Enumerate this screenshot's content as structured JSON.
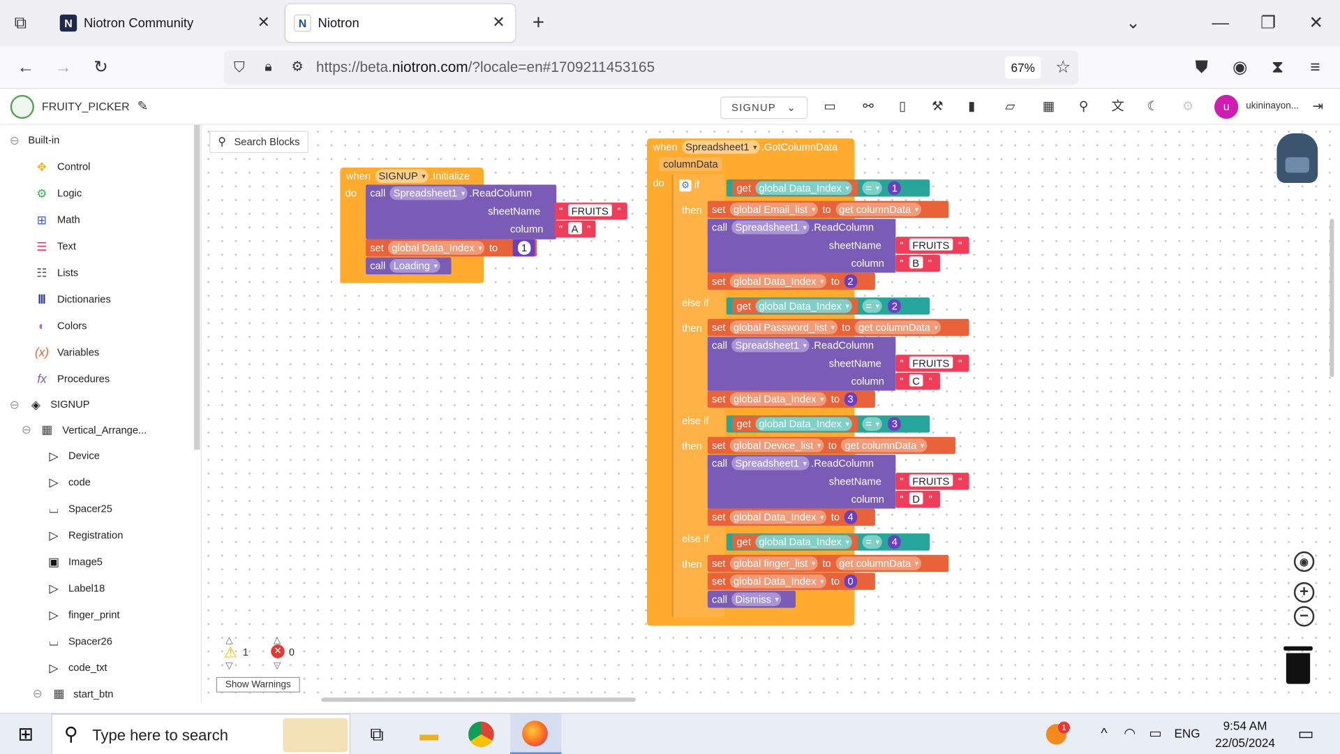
{
  "browser": {
    "tabs": [
      {
        "label": "Niotron Community"
      },
      {
        "label": "Niotron"
      }
    ],
    "url_prefix": "https://beta.",
    "url_domain": "niotron.com",
    "url_suffix": "/?locale=en#1709211453165",
    "zoom": "67%"
  },
  "header": {
    "project_name": "FRUITY_PICKER",
    "screen": "SIGNUP",
    "avatar_letter": "u",
    "username": "ukininayon..."
  },
  "sidebar": {
    "builtin_label": "Built-in",
    "builtin": [
      "Control",
      "Logic",
      "Math",
      "Text",
      "Lists",
      "Dictionaries",
      "Colors",
      "Variables",
      "Procedures"
    ],
    "screen_label": "SIGNUP",
    "arrangement_label": "Vertical_Arrange...",
    "components": [
      "Device",
      "code",
      "Spacer25",
      "Registration",
      "Image5",
      "Label18",
      "finger_print",
      "Spacer26",
      "code_txt"
    ],
    "last_label": "start_btn"
  },
  "workspace": {
    "search_label": "Search Blocks",
    "warnings_count": "1",
    "errors_count": "0",
    "show_warnings": "Show Warnings"
  },
  "blocks": {
    "kw": {
      "when": "when",
      "do": "do",
      "call": "call",
      "set": "set",
      "to": "to",
      "get": "get",
      "if": "if",
      "then": "then",
      "elseif": "else if",
      "eq": "=",
      "sheet": "sheetName",
      "col": "column"
    },
    "init": {
      "component": "SIGNUP",
      "event": ".Initialize",
      "spreadsheet": "Spreadsheet1",
      "method": ".ReadColumn",
      "sheet": "FRUITS",
      "column": "A",
      "var": "global Data_Index",
      "value": "1",
      "loading": "Loading"
    },
    "got": {
      "component": "Spreadsheet1",
      "event": ".GotColumnData",
      "param": "columnData",
      "dismiss": "Dismiss"
    },
    "branches": [
      {
        "cmp": "1",
        "list": "global Email_list",
        "column": "B",
        "next": "2"
      },
      {
        "cmp": "2",
        "list": "global Password_list",
        "column": "C",
        "next": "3"
      },
      {
        "cmp": "3",
        "list": "global Device_list",
        "column": "D",
        "next": "4"
      },
      {
        "cmp": "4",
        "list": "global finger_list",
        "next": "0"
      }
    ]
  },
  "taskbar": {
    "search_placeholder": "Type here to search",
    "lang": "ENG",
    "time": "9:54 AM",
    "date": "22/05/2024",
    "notif_count": "1"
  }
}
